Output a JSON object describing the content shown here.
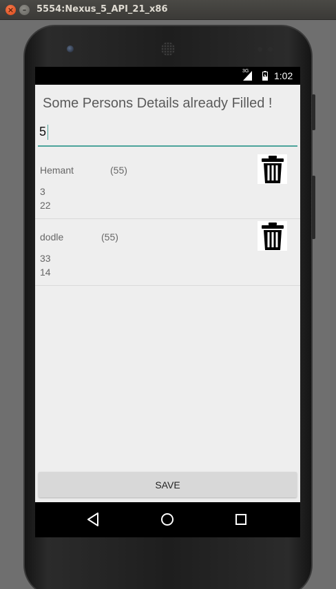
{
  "window": {
    "title": "5554:Nexus_5_API_21_x86"
  },
  "status_bar": {
    "network": "3G",
    "time": "1:02"
  },
  "app": {
    "heading": "Some Persons Details already Filled !",
    "input_value": "5",
    "persons": [
      {
        "name": "Hemant",
        "age": "(55)",
        "line1": "3",
        "line2": "22"
      },
      {
        "name": "dodle",
        "age": "(55)",
        "line1": "33",
        "line2": "14"
      }
    ],
    "save_label": "SAVE"
  },
  "icons": {
    "delete": "trash-icon",
    "nav_back": "back-triangle-icon",
    "nav_home": "home-circle-icon",
    "nav_recents": "recents-square-icon"
  },
  "colors": {
    "accent": "#4aa39a",
    "screen_bg": "#eeeeee",
    "button_bg": "#d8d8d8"
  }
}
